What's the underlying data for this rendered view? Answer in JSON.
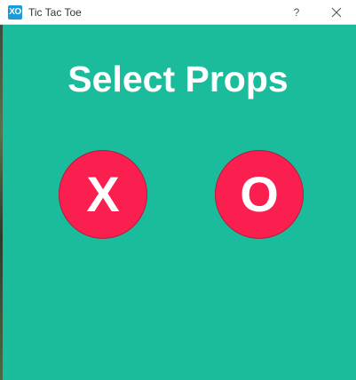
{
  "window": {
    "icon_label": "XO",
    "title": "Tic Tac Toe",
    "help_label": "?"
  },
  "main": {
    "heading": "Select Props",
    "props": [
      {
        "label": "X"
      },
      {
        "label": "O"
      }
    ]
  },
  "colors": {
    "background": "#1abc9c",
    "prop_button": "#fb1f4f",
    "text": "#ffffff"
  }
}
